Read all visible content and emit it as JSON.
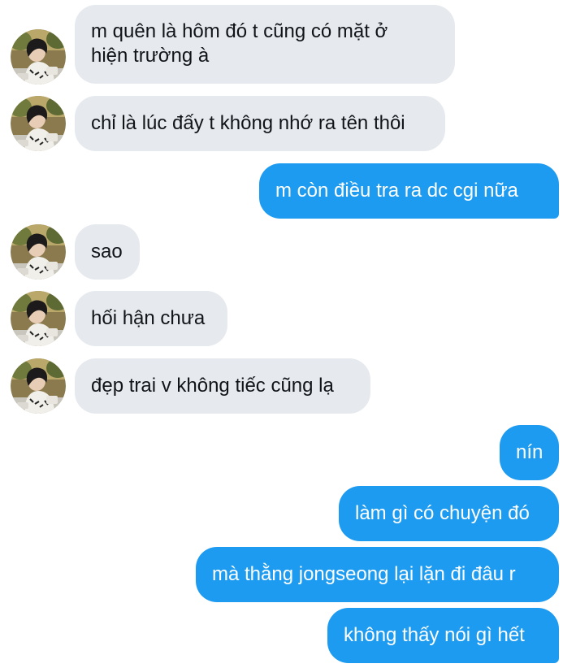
{
  "conversation": {
    "avatar_icon": "contact-avatar-photo",
    "colors": {
      "incoming_bubble": "#e6e9ed",
      "outgoing_bubble": "#1d9bf0",
      "incoming_text": "#111418",
      "outgoing_text": "#ffffff"
    },
    "messages": [
      {
        "direction": "incoming",
        "text": "m quên là hôm đó t cũng có mặt ở\nhiện trường à"
      },
      {
        "direction": "incoming",
        "text": "chỉ là lúc đấy t không nhớ ra tên thôi"
      },
      {
        "direction": "outgoing",
        "text": "m còn điều tra ra dc cgi nữa"
      },
      {
        "direction": "incoming",
        "text": "sao"
      },
      {
        "direction": "incoming",
        "text": "hối hận chưa"
      },
      {
        "direction": "incoming",
        "text": "đẹp trai v không tiếc cũng lạ"
      },
      {
        "direction": "outgoing",
        "text": "nín"
      },
      {
        "direction": "outgoing",
        "text": "làm gì có chuyện đó"
      },
      {
        "direction": "outgoing",
        "text": "mà thằng jongseong lại lặn đi đâu r"
      },
      {
        "direction": "outgoing",
        "text": "không thấy nói gì hết"
      }
    ]
  }
}
